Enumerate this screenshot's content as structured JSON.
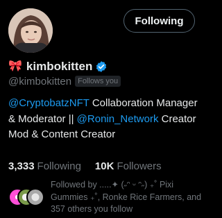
{
  "profile": {
    "display_name": "kimbokitten",
    "handle": "@kimbokitten",
    "follows_you_badge": "Follows you",
    "name_emoji": "🎀"
  },
  "actions": {
    "following_button": "Following"
  },
  "bio": {
    "mention_1": "@CryptobatzNFT",
    "text_1": " Collaboration Manager & Moderator || ",
    "mention_2": "@Ronin_Network",
    "text_2": " Creator Mod & Content Creator"
  },
  "stats": {
    "following_count": "3,333",
    "following_label": "Following",
    "followers_count": "10K",
    "followers_label": "Followers"
  },
  "followed_by": {
    "text": "Followed by .....✦ (˶ᵔ ᵕ ᵔ˶) ₊˚ Pixi Gummies ₊˚, Ronke Rice Farmers, and 357 others you follow"
  },
  "colors": {
    "background": "#000000",
    "text_primary": "#e7e9ea",
    "text_secondary": "#71767b",
    "link": "#1d9bf0",
    "verified_badge": "#1d9bf0"
  },
  "icons": {
    "verified": "verified-badge-icon",
    "bow": "ribbon-bow-emoji"
  }
}
